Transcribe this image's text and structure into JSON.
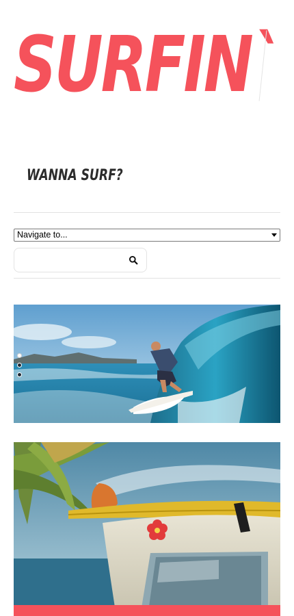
{
  "brand": {
    "logo_text": "SURFIN`",
    "accent_color": "#f5525b"
  },
  "tagline": "WANNA SURF?",
  "navigation": {
    "select_value": "Navigate to..."
  },
  "search": {
    "value": "",
    "placeholder": "",
    "icon": "search-icon"
  },
  "slider": {
    "slides": [
      {
        "subject": "surfer riding a breaking wave"
      },
      {
        "subject": "surfboard on roof of vintage van under palm tree"
      }
    ],
    "pagination_count": 3,
    "active_index": 0
  }
}
